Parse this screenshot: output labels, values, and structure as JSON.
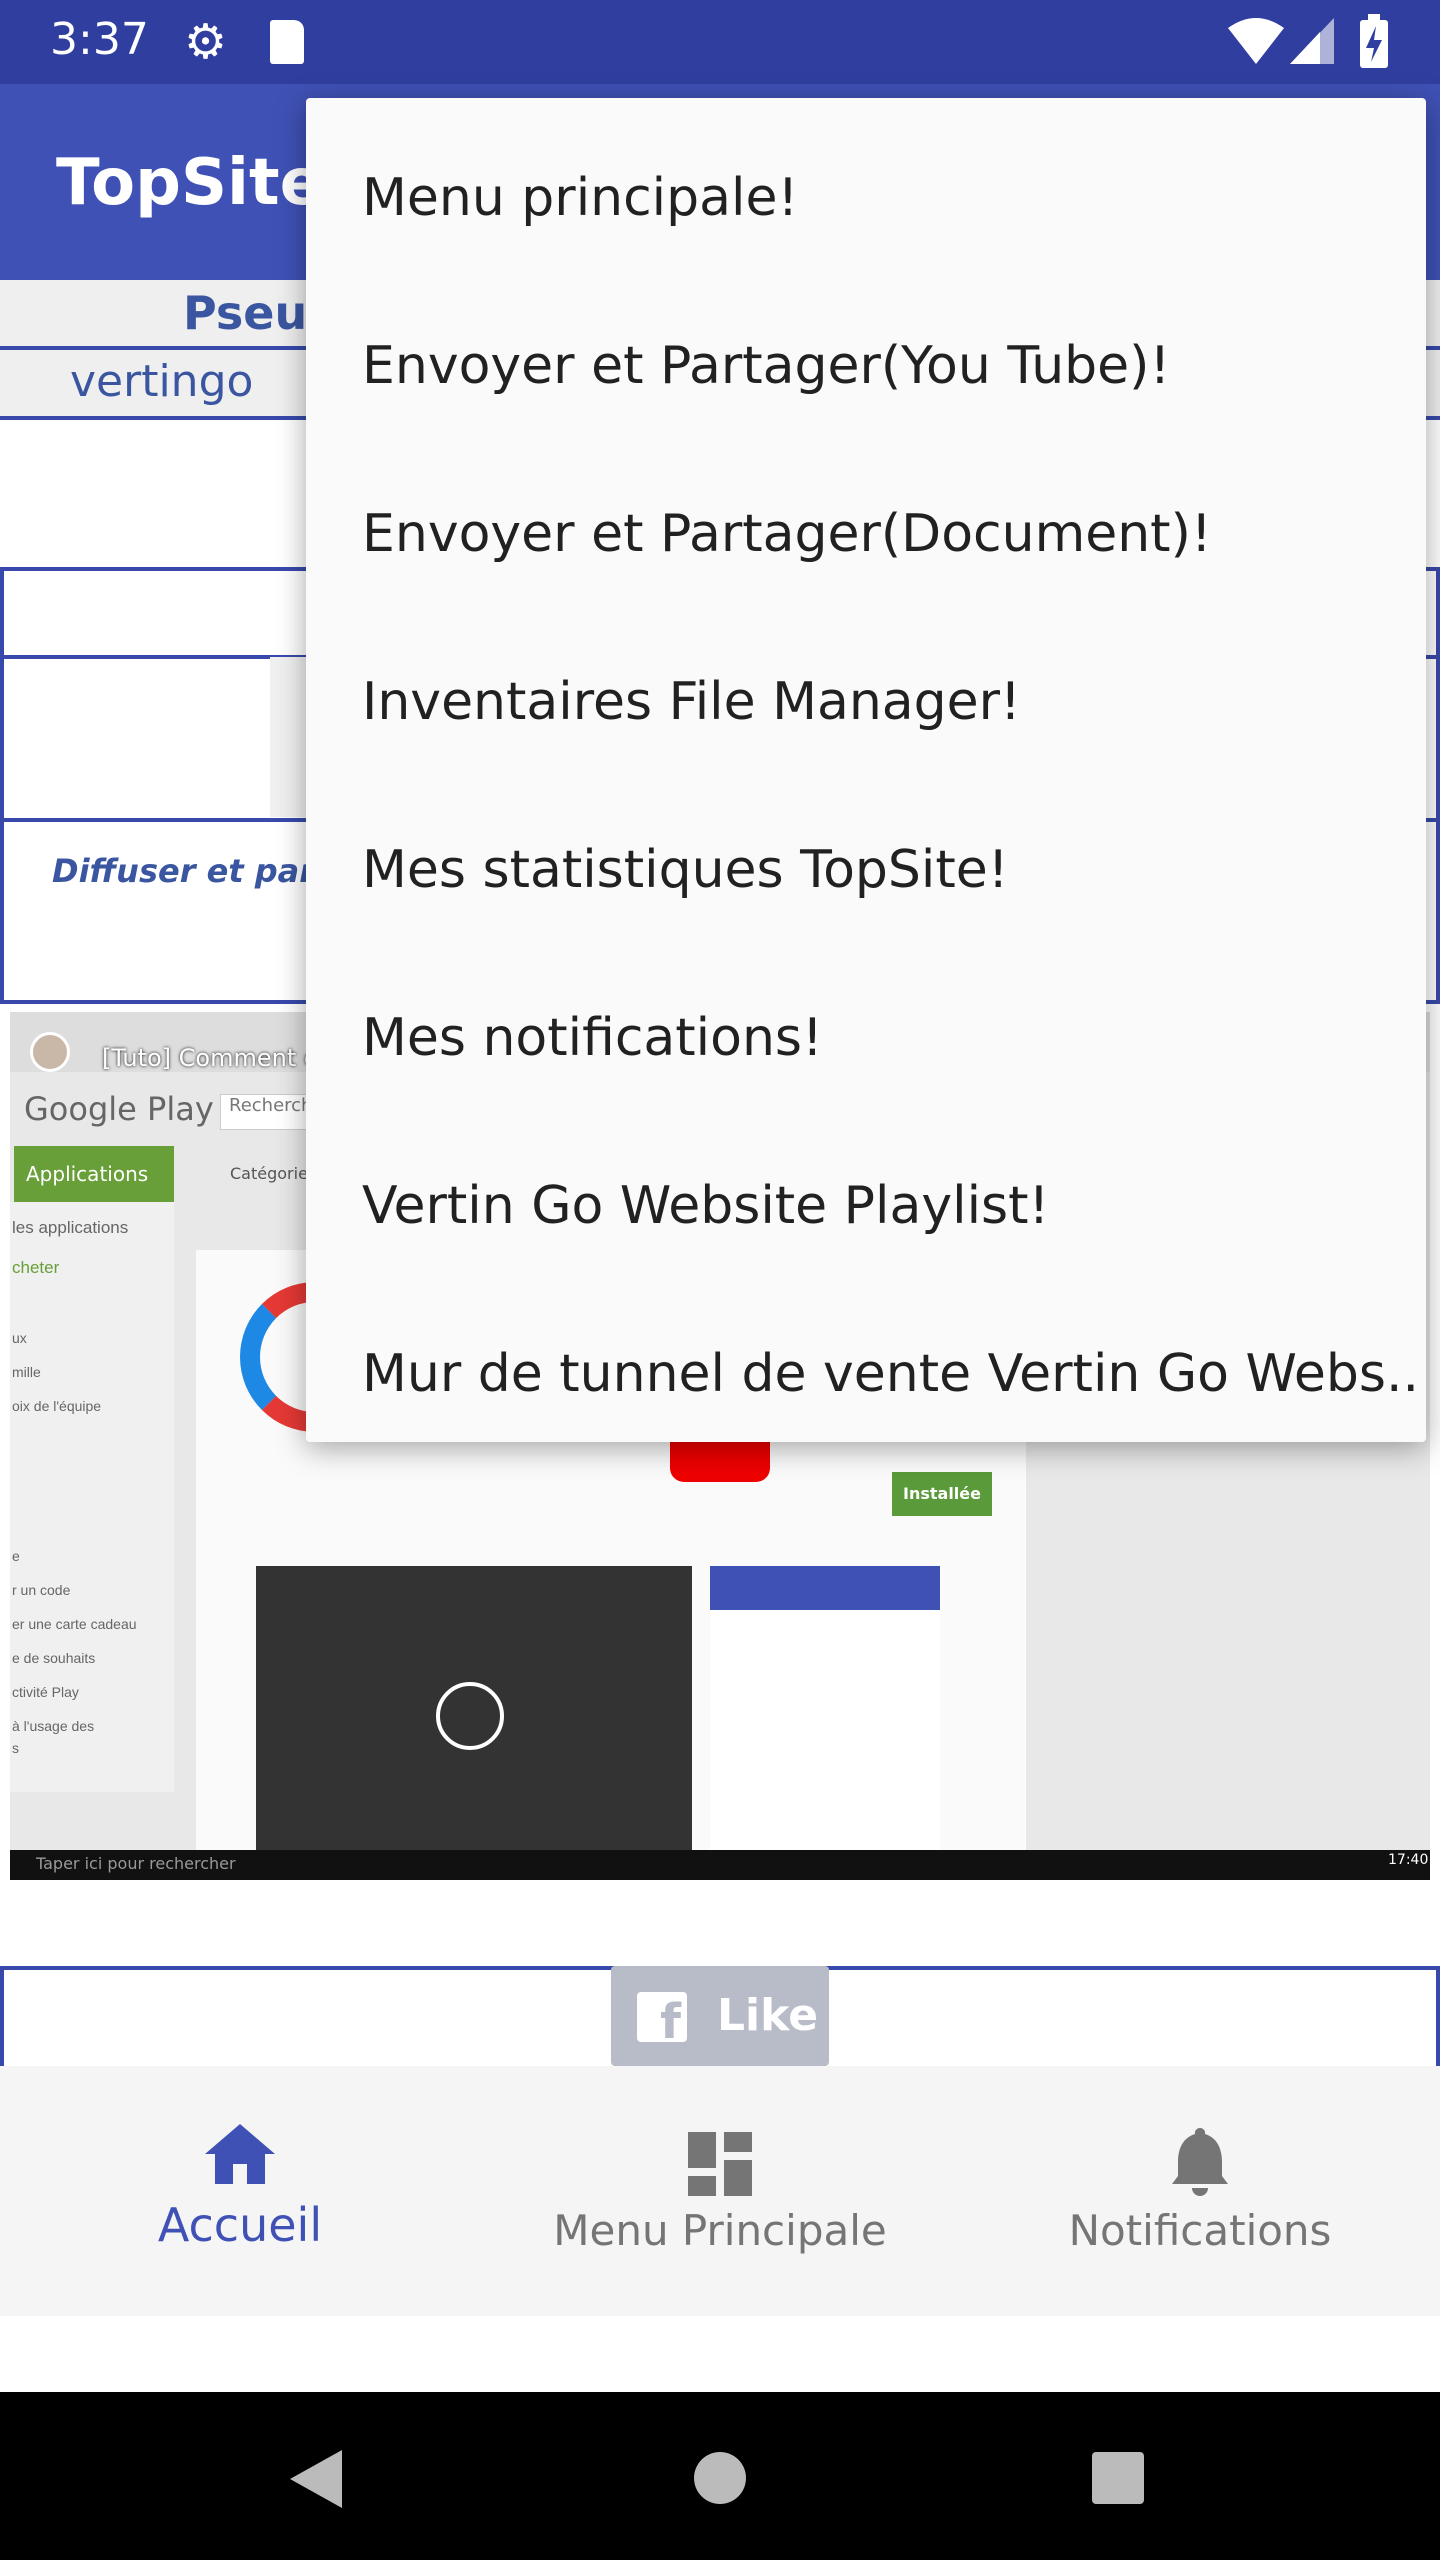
{
  "status_bar": {
    "time": "3:37",
    "icons": [
      "gear-icon",
      "sd-card-icon",
      "wifi-icon",
      "signal-icon",
      "battery-charging-icon"
    ]
  },
  "app_bar": {
    "title": "TopSiteApp"
  },
  "profile": {
    "pseudo_label": "Pseudo",
    "pseudo_value": "vertingo"
  },
  "content": {
    "tagline": "Diffuser et partag"
  },
  "video": {
    "title": "[Tuto] Comment c",
    "store_name": "Google Play",
    "search_placeholder": "Recherch",
    "tab_applications": "Applications",
    "tab_categories": "Catégories",
    "sidebar": [
      "les applications",
      "cheter",
      "ux",
      "mille",
      "oix de l'équipe",
      "e",
      "r un code",
      "er une carte cadeau",
      "e de souhaits",
      "ctivité Play",
      "à l'usage des",
      "s"
    ],
    "installed_label": "Installée",
    "taskbar_search": "Taper ici pour rechercher",
    "taskbar_time": "17:40"
  },
  "like_button": {
    "label": "Like"
  },
  "overflow_menu": {
    "items": [
      "Menu principale!",
      "Envoyer et Partager(You Tube)!",
      "Envoyer et Partager(Document)!",
      "Inventaires File Manager!",
      "Mes statistiques TopSite!",
      "Mes notifications!",
      "Vertin Go Website Playlist!",
      "Mur de tunnel de vente Vertin Go Webs.."
    ]
  },
  "bottom_nav": {
    "items": [
      {
        "label": "Accueil",
        "icon": "home-icon",
        "active": true
      },
      {
        "label": "Menu Principale",
        "icon": "dashboard-icon",
        "active": false
      },
      {
        "label": "Notifications",
        "icon": "bell-icon",
        "active": false
      }
    ]
  },
  "colors": {
    "primary": "#3f51b5",
    "primary_dark": "#303f9f",
    "like_bg": "#b8bcc8",
    "play_green": "#689f38"
  }
}
